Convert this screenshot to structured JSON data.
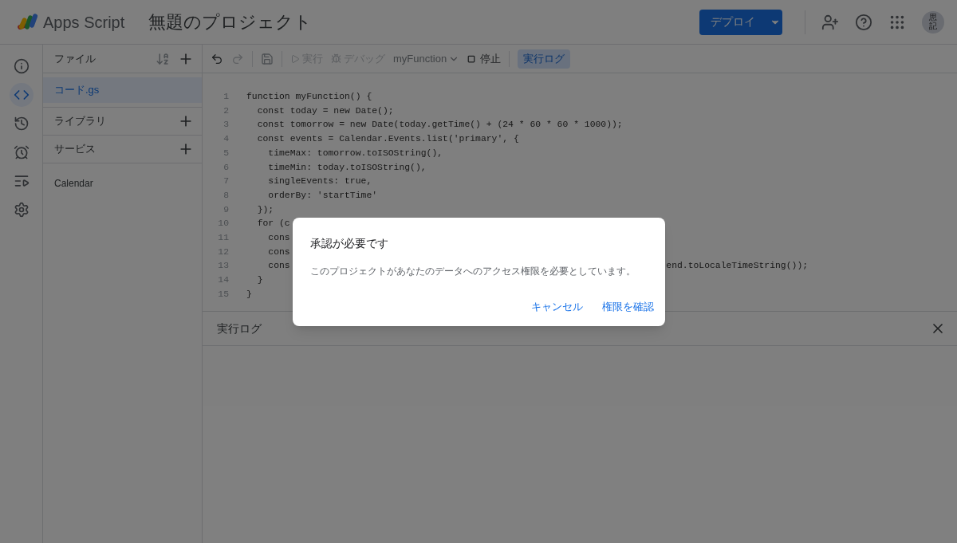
{
  "header": {
    "app_name": "Apps Script",
    "project_title": "無題のプロジェクト",
    "deploy_button": "デプロイ",
    "avatar": "思記"
  },
  "rail": [
    {
      "kind": "info",
      "selected": false
    },
    {
      "kind": "code",
      "selected": true
    },
    {
      "kind": "history",
      "selected": false
    },
    {
      "kind": "alarm",
      "selected": false
    },
    {
      "kind": "executions",
      "selected": false
    },
    {
      "kind": "settings",
      "selected": false
    }
  ],
  "files_panel": {
    "title": "ファイル",
    "files": [
      {
        "name": "コード.gs",
        "selected": true
      }
    ],
    "sections": [
      {
        "title": "ライブラリ"
      },
      {
        "title": "サービス"
      }
    ],
    "services": [
      "Calendar"
    ]
  },
  "toolbar": {
    "run": {
      "label": "実行",
      "disabled": true
    },
    "debug": {
      "label": "デバッグ",
      "disabled": true
    },
    "function_select": "myFunction",
    "stop": "停止",
    "log_toggle": {
      "label": "実行ログ",
      "selected": true
    }
  },
  "code": [
    {
      "number": "1",
      "text": "function myFunction() {"
    },
    {
      "number": "2",
      "text": "  const today = new Date();"
    },
    {
      "number": "3",
      "text": "  const tomorrow = new Date(today.getTime() + (24 * 60 * 60 * 1000));"
    },
    {
      "number": "4",
      "text": "  const events = Calendar.Events.list('primary', {"
    },
    {
      "number": "5",
      "text": "    timeMax: tomorrow.toISOString(),"
    },
    {
      "number": "6",
      "text": "    timeMin: today.toISOString(),"
    },
    {
      "number": "7",
      "text": "    singleEvents: true,"
    },
    {
      "number": "8",
      "text": "    orderBy: 'startTime'"
    },
    {
      "number": "9",
      "text": "  });"
    },
    {
      "number": "10",
      "text": "  for (c"
    },
    {
      "number": "11",
      "text": "    cons"
    },
    {
      "number": "12",
      "text": "    cons"
    },
    {
      "number": "13",
      "text": "    cons",
      "continuation": "end.toLocaleTimeString());"
    },
    {
      "number": "14",
      "text": "  }"
    },
    {
      "number": "15",
      "text": "}"
    }
  ],
  "log_panel": {
    "title": "実行ログ"
  },
  "dialog": {
    "title": "承認が必要です",
    "message": "このプロジェクトがあなたのデータへのアクセス権限を必要としています。",
    "buttons": [
      "キャンセル",
      "権限を確認"
    ]
  }
}
